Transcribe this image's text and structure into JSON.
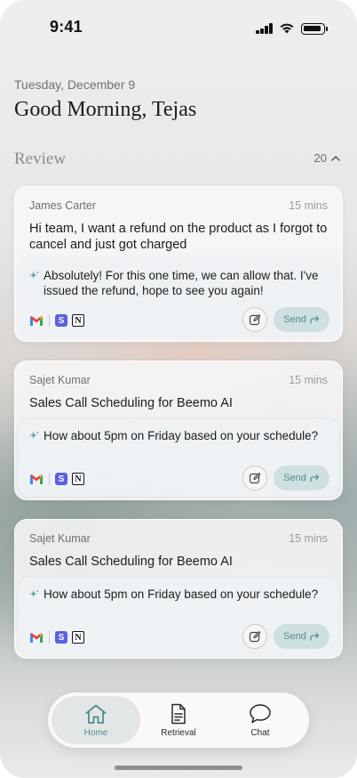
{
  "status_bar": {
    "time": "9:41"
  },
  "header": {
    "date": "Tuesday, December 9",
    "greeting": "Good Morning, Tejas"
  },
  "review": {
    "title": "Review",
    "count": "20"
  },
  "cards": [
    {
      "sender": "James Carter",
      "time_ago": "15 mins",
      "subject": "Hi team, I want a refund on the product as I forgot to cancel and just got charged",
      "reply": "Absolutely! For this one time, we can allow that. I've issued the refund, hope to see you again!",
      "send_label": "Send"
    },
    {
      "sender": "Sajet Kumar",
      "time_ago": "15 mins",
      "subject": "Sales Call Scheduling for Beemo AI",
      "reply": "How about 5pm on Friday based on your schedule?",
      "send_label": "Send"
    },
    {
      "sender": "Sajet Kumar",
      "time_ago": "15 mins",
      "subject": "Sales Call Scheduling for Beemo AI",
      "reply": "How about 5pm on Friday based on your schedule?",
      "send_label": "Send"
    }
  ],
  "app_badges": {
    "s": "S",
    "n": "N"
  },
  "tabs": [
    {
      "label": "Home",
      "icon": "home-icon",
      "active": true
    },
    {
      "label": "Retrieval",
      "icon": "document-icon",
      "active": false
    },
    {
      "label": "Chat",
      "icon": "chat-bubble-icon",
      "active": false
    }
  ],
  "colors": {
    "accent": "#4a8e94",
    "send_bg": "#cfe0e1",
    "app_s": "#5b5fe0"
  }
}
